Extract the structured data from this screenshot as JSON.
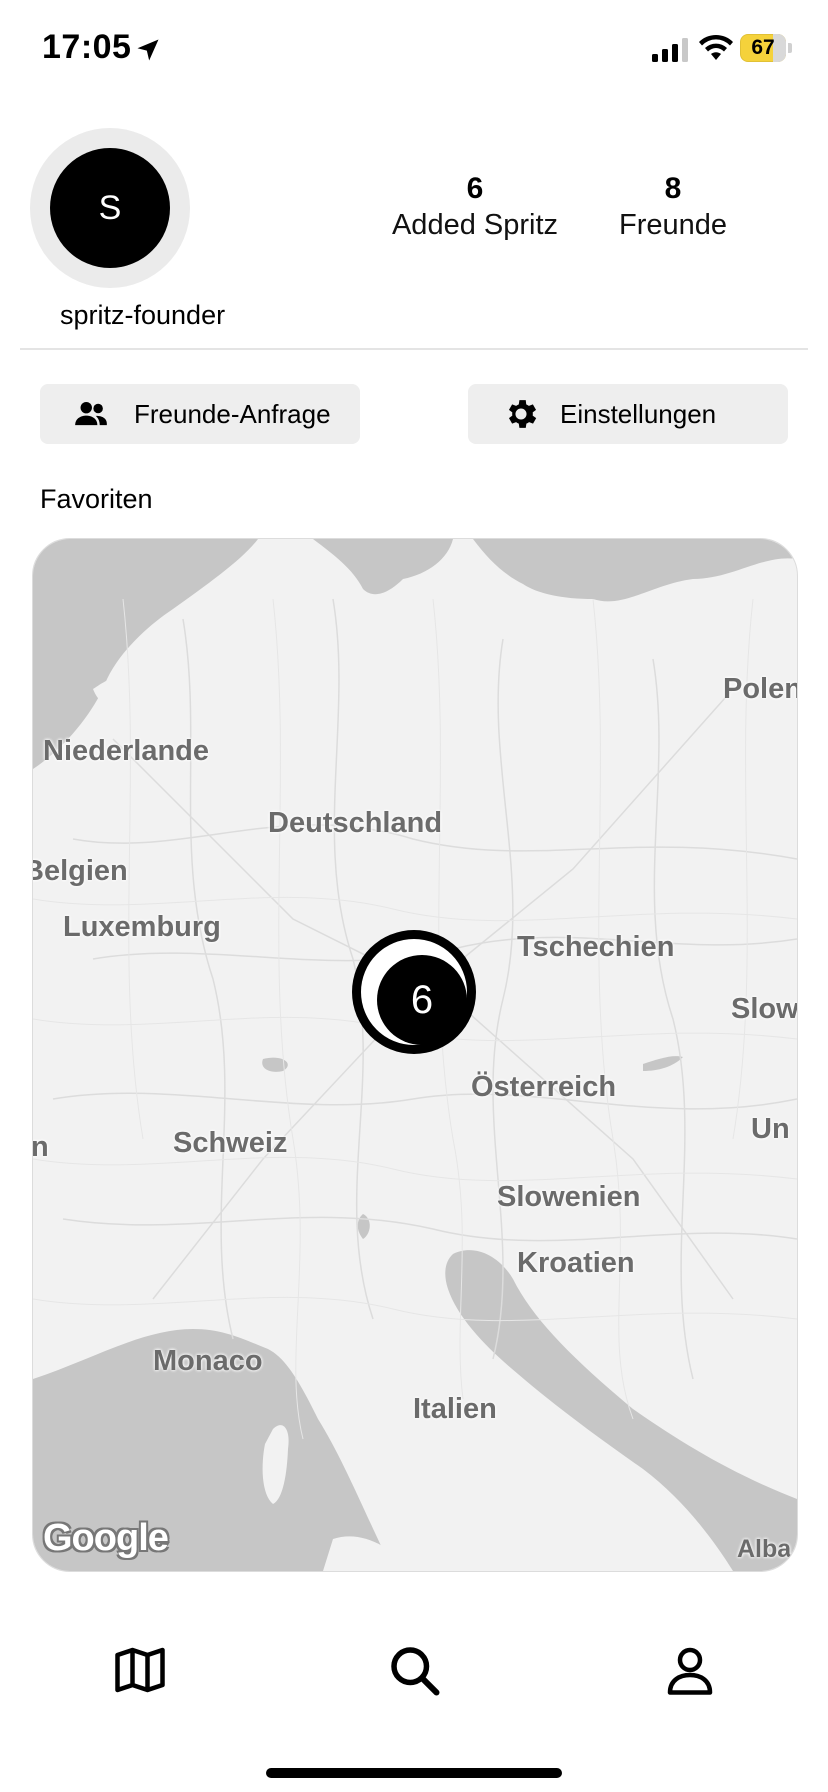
{
  "status_bar": {
    "time": "17:05",
    "battery": "67",
    "icons": [
      "location-arrow-icon",
      "signal-icon",
      "wifi-icon",
      "battery-icon"
    ]
  },
  "profile": {
    "avatar_initial": "S",
    "username": "spritz-founder",
    "stats": [
      {
        "value": "6",
        "label": "Added Spritz"
      },
      {
        "value": "8",
        "label": "Freunde"
      }
    ]
  },
  "actions": {
    "friends_request": {
      "label": "Freunde-Anfrage",
      "icon": "people-icon"
    },
    "settings": {
      "label": "Einstellungen",
      "icon": "gear-icon"
    }
  },
  "favorites": {
    "title": "Favoriten",
    "map": {
      "labels": [
        "Polen",
        "Niederlande",
        "Deutschland",
        "Belgien",
        "Luxemburg",
        "Tschechien",
        "Slow",
        "Österreich",
        "Schweiz",
        "Un",
        "Slowenien",
        "Kroatien",
        "Monaco",
        "Italien",
        "Alba",
        "n"
      ],
      "cluster_count": "6",
      "attribution": "Google"
    }
  },
  "tabbar": {
    "items": [
      {
        "name": "map",
        "icon": "map-icon"
      },
      {
        "name": "search",
        "icon": "search-icon"
      },
      {
        "name": "profile",
        "icon": "person-icon"
      }
    ]
  }
}
